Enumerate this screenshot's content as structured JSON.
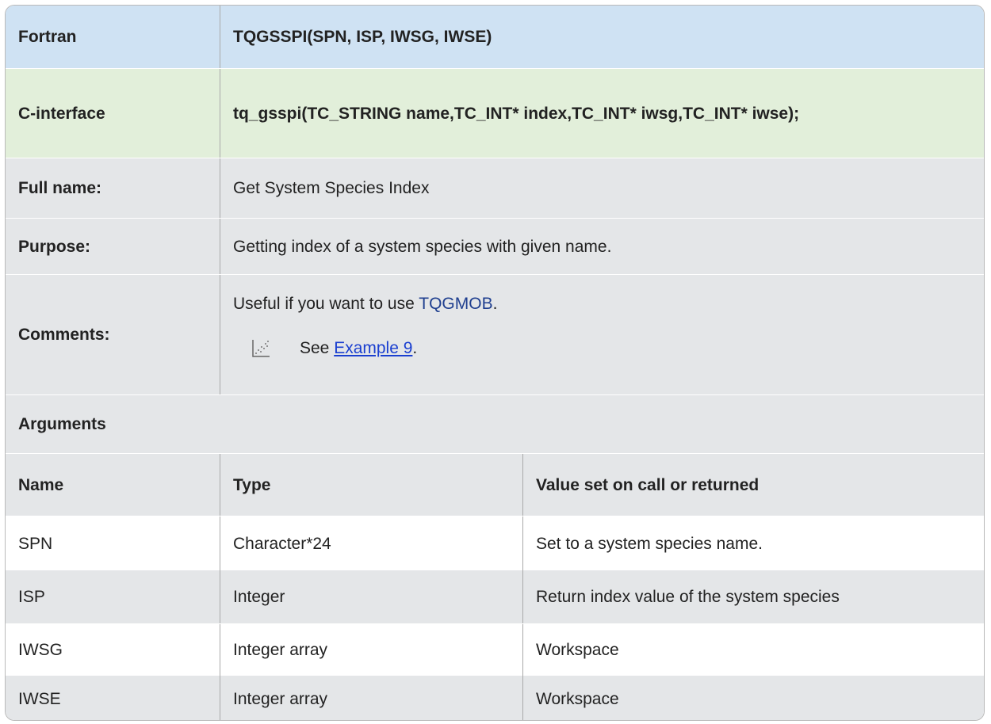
{
  "header": {
    "fortran_label": "Fortran",
    "fortran_signature": "TQGSSPI(SPN, ISP, IWSG, IWSE)",
    "c_label": "C-interface",
    "c_signature": "tq_gsspi(TC_STRING name,TC_INT* index,TC_INT* iwsg,TC_INT* iwse);"
  },
  "info": {
    "full_name_label": "Full name:",
    "full_name_value": "Get System Species Index",
    "purpose_label": "Purpose:",
    "purpose_value": "Getting index of a system species with given name.",
    "comments_label": "Comments:",
    "comments_prefix": "Useful if you want to use ",
    "comments_link": "TQGMOB",
    "comments_suffix": ".",
    "see_prefix": "See ",
    "see_link": "Example 9",
    "see_suffix": ".",
    "see_icon": "example-chart-icon"
  },
  "arguments": {
    "title": "Arguments",
    "columns": [
      "Name",
      "Type",
      "Value set on call or returned"
    ],
    "rows": [
      {
        "name": "SPN",
        "type": "Character*24",
        "value": "Set to a system species name."
      },
      {
        "name": "ISP",
        "type": "Integer",
        "value": "Return index value of the system species"
      },
      {
        "name": "IWSG",
        "type": "Integer array",
        "value": "Workspace"
      },
      {
        "name": "IWSE",
        "type": "Integer array",
        "value": "Workspace"
      }
    ]
  },
  "colors": {
    "fortran_bg": "#cfe2f3",
    "c_bg": "#e2efda",
    "gray_bg": "#e4e6e8",
    "link": "#1a3fd0"
  }
}
